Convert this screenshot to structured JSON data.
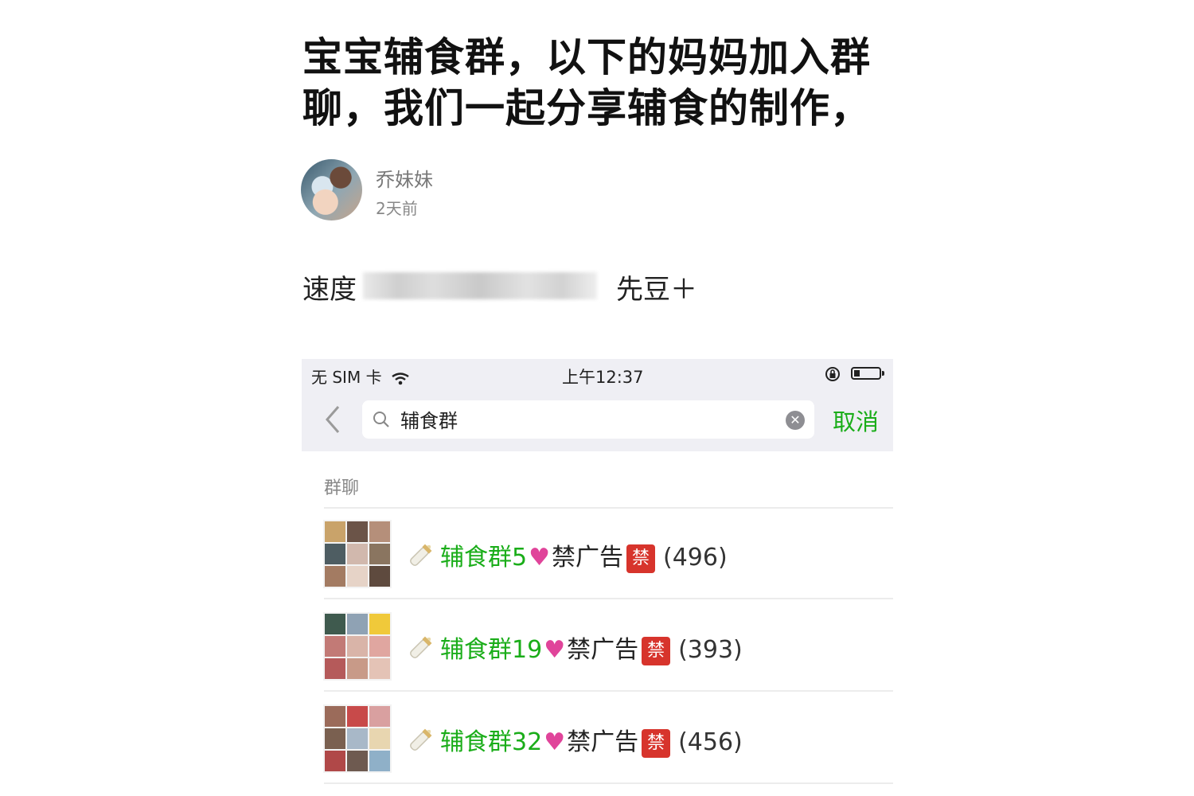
{
  "article": {
    "title": "宝宝辅食群，以下的妈妈加入群聊，我们一起分享辅食的制作，",
    "author": "乔妹妹",
    "time": "2天前",
    "body_start": "速度",
    "body_end": "先豆＋"
  },
  "phone": {
    "status": {
      "carrier": "无 SIM 卡",
      "time": "上午12:37"
    },
    "search": {
      "value": "辅食群",
      "cancel_label": "取消"
    },
    "section_label": "群聊",
    "results": [
      {
        "prefix": "辅食群5",
        "suffix": "禁广告",
        "badge": "禁",
        "count": "(496)"
      },
      {
        "prefix": "辅食群19",
        "suffix": "禁广告",
        "badge": "禁",
        "count": "(393)"
      },
      {
        "prefix": "辅食群32",
        "suffix": "禁广告",
        "badge": "禁",
        "count": "(456)"
      }
    ],
    "colors": {
      "accent": "#1aad19",
      "badge": "#d7342c",
      "heart": "#e0449a"
    }
  }
}
